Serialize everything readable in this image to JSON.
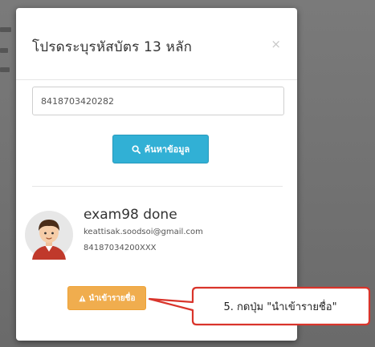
{
  "modal": {
    "title": "โปรดระบุรหัสบัตร 13 หลัก",
    "close_icon": "×"
  },
  "search": {
    "input_value": "8418703420282",
    "button_label": "ค้นหาข้อมูล",
    "button_icon": "search-icon",
    "button_color": "#31b0d5"
  },
  "user": {
    "name": "exam98 done",
    "email": "keattisak.soodsoi@gmail.com",
    "id": "84187034200XXX",
    "avatar_icon": "user-avatar-icon"
  },
  "import": {
    "button_label": "นำเข้ารายชื่อ",
    "button_icon": "warning-icon",
    "button_color": "#f0ad4e"
  },
  "callout": {
    "text": "5. กดปุ่ม \"นำเข้ารายชื่อ\"",
    "border_color": "#d9342b"
  }
}
